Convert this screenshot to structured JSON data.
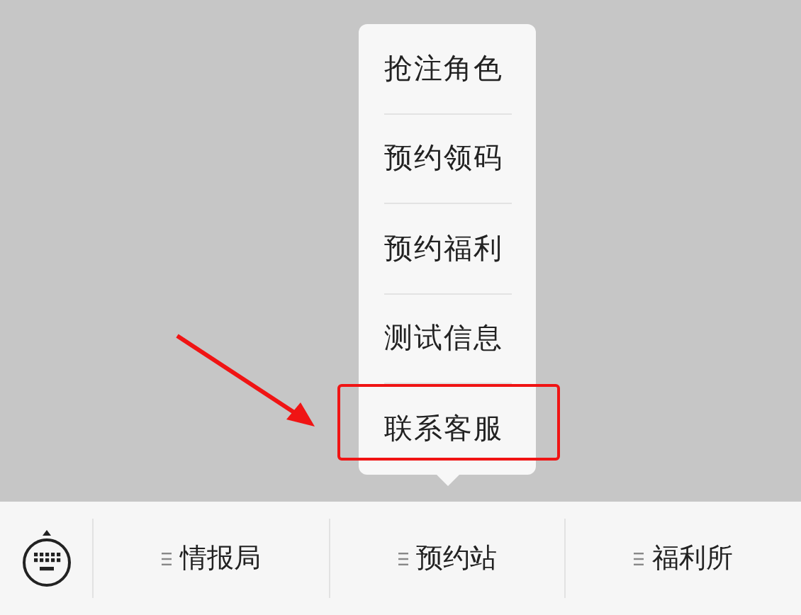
{
  "popup_menu": {
    "items": [
      {
        "label": "抢注角色",
        "highlighted": false
      },
      {
        "label": "预约领码",
        "highlighted": false
      },
      {
        "label": "预约福利",
        "highlighted": false
      },
      {
        "label": "测试信息",
        "highlighted": false
      },
      {
        "label": "联系客服",
        "highlighted": true
      }
    ]
  },
  "bottom_menu": {
    "tabs": [
      {
        "label": "情报局"
      },
      {
        "label": "预约站"
      },
      {
        "label": "福利所"
      }
    ]
  }
}
